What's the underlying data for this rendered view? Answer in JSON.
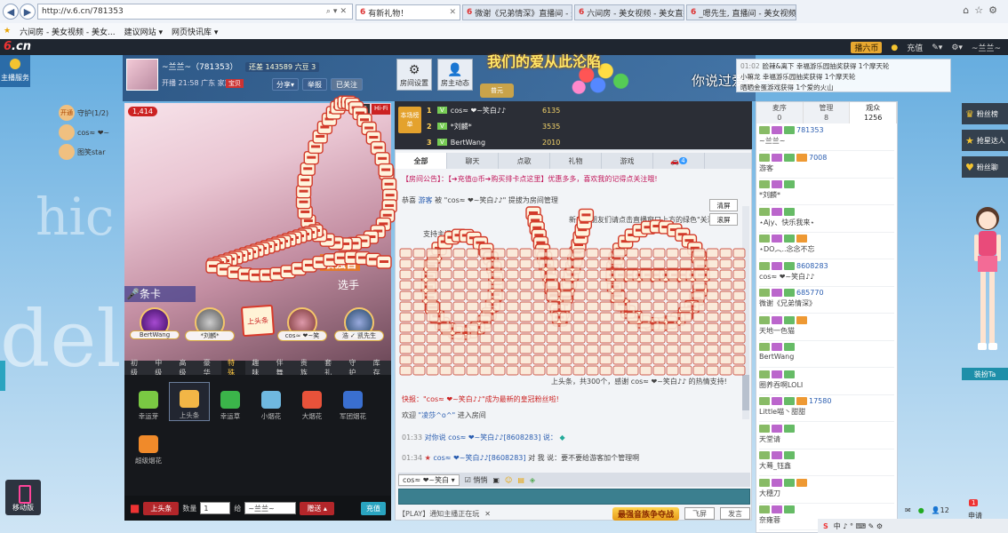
{
  "browser": {
    "url": "http://v.6.cn/781353",
    "tabs": [
      {
        "label": "有新礼物！",
        "active": true
      },
      {
        "label": "微谢《兄弟情深》直播间 - 美..."
      },
      {
        "label": "六间房 - 美女视频 - 美女直播..."
      },
      {
        "label": "_嗯先生, 直播间 - 美女视频聊..."
      }
    ],
    "favorites": [
      "六间房 - 美女视频 - 美女...",
      "建议网站 ▾",
      "网页快讯库 ▾"
    ]
  },
  "site": {
    "logo_num": "6",
    "logo_text": ".cn",
    "user_coin_label": "播六币",
    "recharge": "充值",
    "user_name": "~兰兰~"
  },
  "left_service": "主播服务",
  "bg_words": {
    "hi": "hic",
    "del": "del"
  },
  "anchor": {
    "name": "~兰兰~（781353）",
    "level": "还差 143589 六豆 3",
    "meta": "开播 21:58  广东  家族",
    "fan_badge": "宝贝",
    "share": "分享",
    "report": "举报",
    "follow": "已关注",
    "room_settings": "房间设置",
    "anchor_news": "房主动态"
  },
  "marquee": {
    "title": "我们的爱从此沦陷",
    "right": "你说过爱我一万年",
    "pkg": "普元"
  },
  "notices": [
    {
      "time": "01:02",
      "text": "脸辣&离下 幸福游乐园抽奖获得 1个摩天轮"
    },
    {
      "time": "",
      "text": "小嘛龙 幸福游乐园抽奖获得 1个摩天轮"
    },
    {
      "time": "",
      "text": "晒晒金蛋游戏获得 1个爱的火山"
    }
  ],
  "guard": {
    "open_label": "开通",
    "title": "守护(1/2)",
    "members": [
      "cos≈ ❤~",
      "图笑star"
    ]
  },
  "video": {
    "count": "1,414",
    "tags": [
      "直播",
      "Hi-Fi"
    ],
    "brand_text": "最强音",
    "brand_sub": "选手",
    "card_strip": "条卡"
  },
  "seats": [
    "BertWang",
    "*刘麟*",
    "cos≈ ❤~笑",
    "浩 ✓ 凯先生"
  ],
  "headline_sign": "上头条",
  "gift_tabs": [
    "初级",
    "中级",
    "高级",
    "豪华",
    "特殊",
    "趣味",
    "伴舞",
    "贵族",
    "套礼",
    "守护",
    "库存"
  ],
  "gift_active_tab": 4,
  "gifts": [
    {
      "name": "幸运芽",
      "color": "#7ac943"
    },
    {
      "name": "上头条",
      "color": "#f2b646",
      "selected": true
    },
    {
      "name": "幸运草",
      "color": "#3bb44a"
    },
    {
      "name": "小烟花",
      "color": "#6fb8e0"
    },
    {
      "name": "大烟花",
      "color": "#e8523a"
    },
    {
      "name": "军团烟花",
      "color": "#3a6fd0"
    },
    {
      "name": "超级烟花",
      "color": "#f08a2a"
    }
  ],
  "gift_bar": {
    "gift": "上头条",
    "qty_label": "数量",
    "qty": "1",
    "to_label": "给",
    "target": "~兰兰~",
    "send": "赠送 ▴",
    "recharge": "充值"
  },
  "rank": {
    "logo": "本场榜单",
    "rows": [
      {
        "num": "1",
        "name": "cos≈ ❤~笑白♪♪",
        "value": "6135"
      },
      {
        "num": "2",
        "name": "*刘麟*",
        "value": "3535"
      },
      {
        "num": "3",
        "name": "BertWang",
        "value": "2010"
      }
    ]
  },
  "chat": {
    "tabs": [
      "全部",
      "聊天",
      "点歌",
      "礼物",
      "游戏"
    ],
    "car_badge": "4",
    "notice": "【房间公告】：【➔充值◎币➔购买排卡点这里】优惠多多，喜欢我的记得点关注哦!",
    "lines": [
      {
        "prefix": "恭喜",
        "user": "游客",
        "middle": "被 \"cos≈ ❤~笑白♪♪\" 提拔为房间管理"
      },
      {
        "prefix": "",
        "user": "",
        "middle": "新来的朋友们请点击直播窗口上方的绿色\"关注\""
      },
      {
        "prefix": "",
        "user": "",
        "middle": "支持主播的哦"
      },
      {
        "prefix": "",
        "user": "",
        "middle": "上头条，共300个，感谢 cos≈ ❤~笑白♪♪ 的热情支持!"
      }
    ],
    "bulletin": "快报：\"cos≈ ❤~笑白♪♪\"成为最新的皇冠粉丝啦!",
    "welcome_user": "\"凌莎^o^\"",
    "welcome_text": "进入房间",
    "msg1": {
      "time": "01:33",
      "text": "对你说 cos≈ ❤~笑白♪♪[8608283] 说："
    },
    "msg2": {
      "time": "01:34",
      "user": "cos≈ ❤~笑白♪♪[8608283]",
      "text": "对 我 说：要不要给游客加个管理啊"
    },
    "float_clear": "清屏",
    "float_scroll": "滚屏",
    "input_target": "cos≈ ❤~笑白",
    "whisper": "悄悄",
    "play_hint": "【PLAY】通知主播正在玩",
    "join_battle": "最强音族争夺战",
    "fly_screen": "飞屏",
    "send": "发言"
  },
  "audience": {
    "tabs": [
      {
        "label": "麦序",
        "count": "0"
      },
      {
        "label": "管理",
        "count": "8"
      },
      {
        "label": "观众",
        "count": "1256"
      }
    ],
    "rows": [
      {
        "line1": "781353",
        "line2": "~兰兰~"
      },
      {
        "line1": "7008",
        "line2": "游客"
      },
      {
        "line1": "",
        "line2": "*刘麟*"
      },
      {
        "line1": "",
        "line2": "⋆Ajy、快乐我来⋆"
      },
      {
        "line1": "",
        "line2": "⋆DO︵..念念不忘"
      },
      {
        "line1": "8608283",
        "line2": "cos≈ ❤~笑白♪♪"
      },
      {
        "line1": "685770",
        "line2": "微谢《兄弟情深》"
      },
      {
        "line1": "",
        "line2": "天地一色猫"
      },
      {
        "line1": "",
        "line2": "BertWang"
      },
      {
        "line1": "",
        "line2": "圈养吞啊LOLI"
      },
      {
        "line1": "17580",
        "line2": "Little喵丶甜甜"
      },
      {
        "line1": "",
        "line2": "天堂请"
      },
      {
        "line1": "",
        "line2": "大蓦_钰鑫"
      },
      {
        "line1": "",
        "line2": "大穗刀"
      },
      {
        "line1": "",
        "line2": "奈雍蓉"
      }
    ]
  },
  "fan_side": [
    "粉丝榜",
    "抢星达人",
    "粉丝聊"
  ],
  "dress_btn": "装扮Ta",
  "mobile_btn": "移动版",
  "tray": {
    "apply": "申请",
    "apply_badge": "1",
    "count": "12"
  }
}
